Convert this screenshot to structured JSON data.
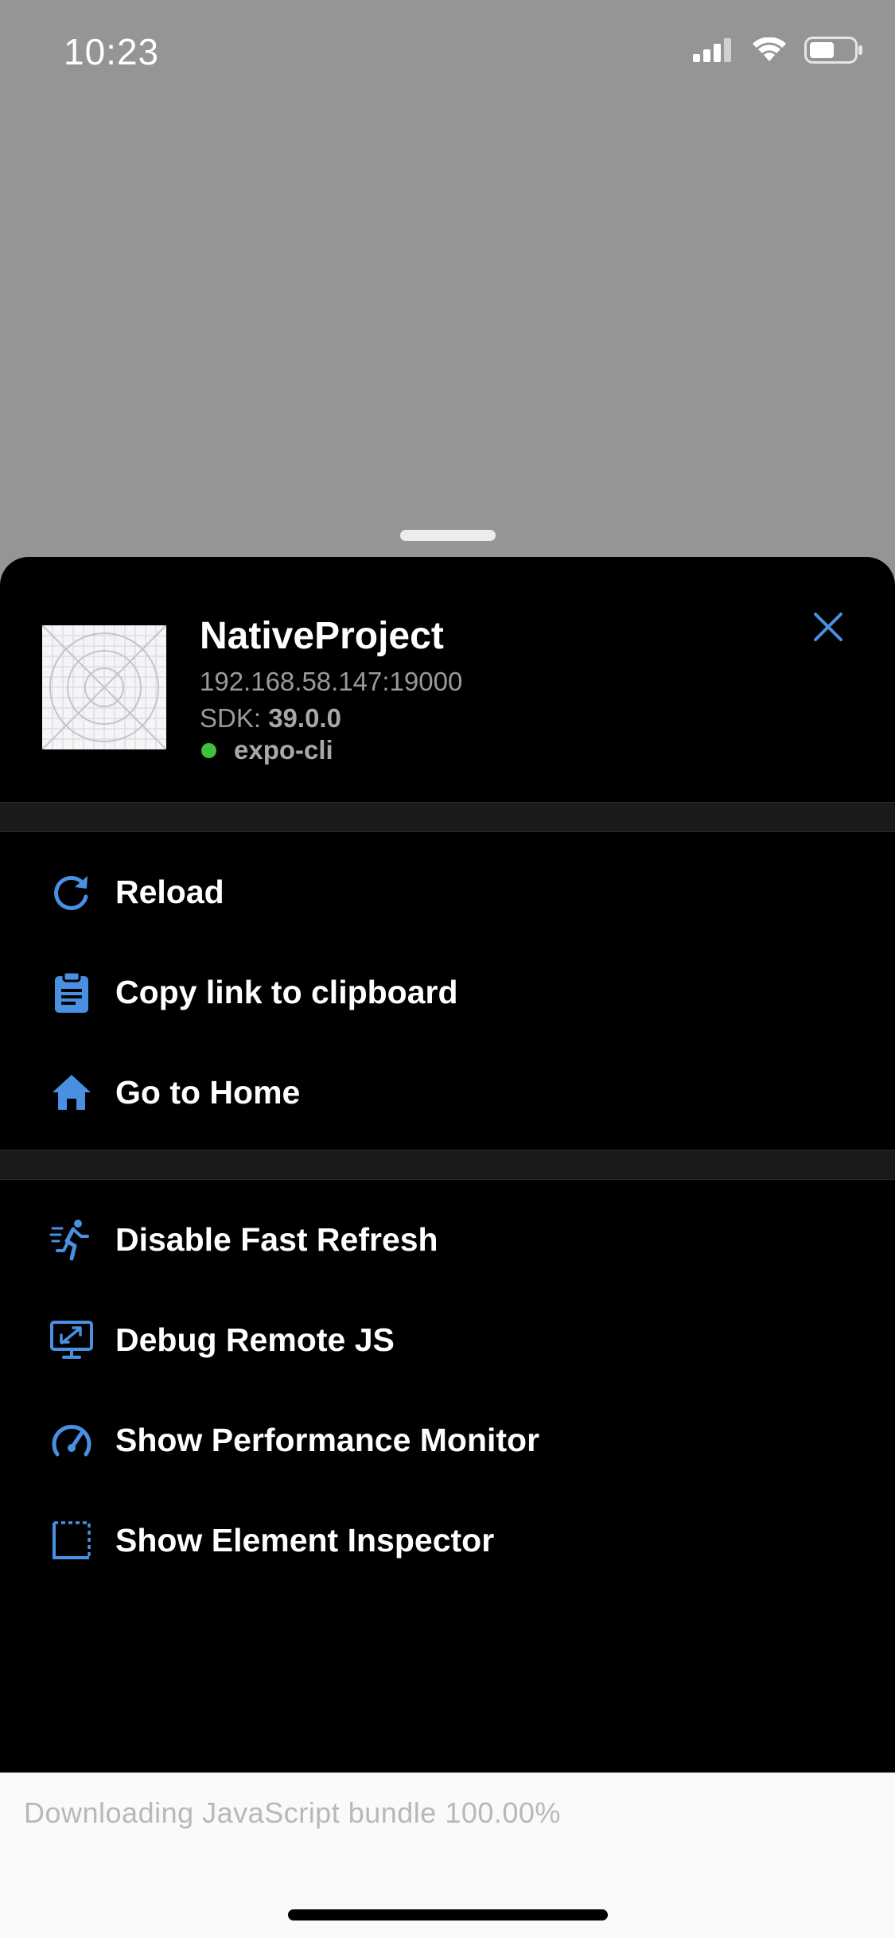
{
  "status_bar": {
    "time": "10:23"
  },
  "project": {
    "name": "NativeProject",
    "host": "192.168.58.147:19000",
    "sdk_label": "SDK:",
    "sdk_version": "39.0.0",
    "runner": "expo-cli",
    "runner_status_color": "#3cc23c"
  },
  "menu": {
    "primary": [
      {
        "label": "Reload",
        "icon": "reload-icon"
      },
      {
        "label": "Copy link to clipboard",
        "icon": "clipboard-icon"
      },
      {
        "label": "Go to Home",
        "icon": "home-icon"
      }
    ],
    "developer": [
      {
        "label": "Disable Fast Refresh",
        "icon": "running-person-icon"
      },
      {
        "label": "Debug Remote JS",
        "icon": "remote-debug-monitor-icon"
      },
      {
        "label": "Show Performance Monitor",
        "icon": "speedometer-icon"
      },
      {
        "label": "Show Element Inspector",
        "icon": "element-inspector-icon"
      }
    ]
  },
  "footer": {
    "text": "Downloading JavaScript bundle 100.00%"
  },
  "colors": {
    "accent": "#4a90e2",
    "sheet_bg": "#000000",
    "backdrop": "#959595"
  }
}
